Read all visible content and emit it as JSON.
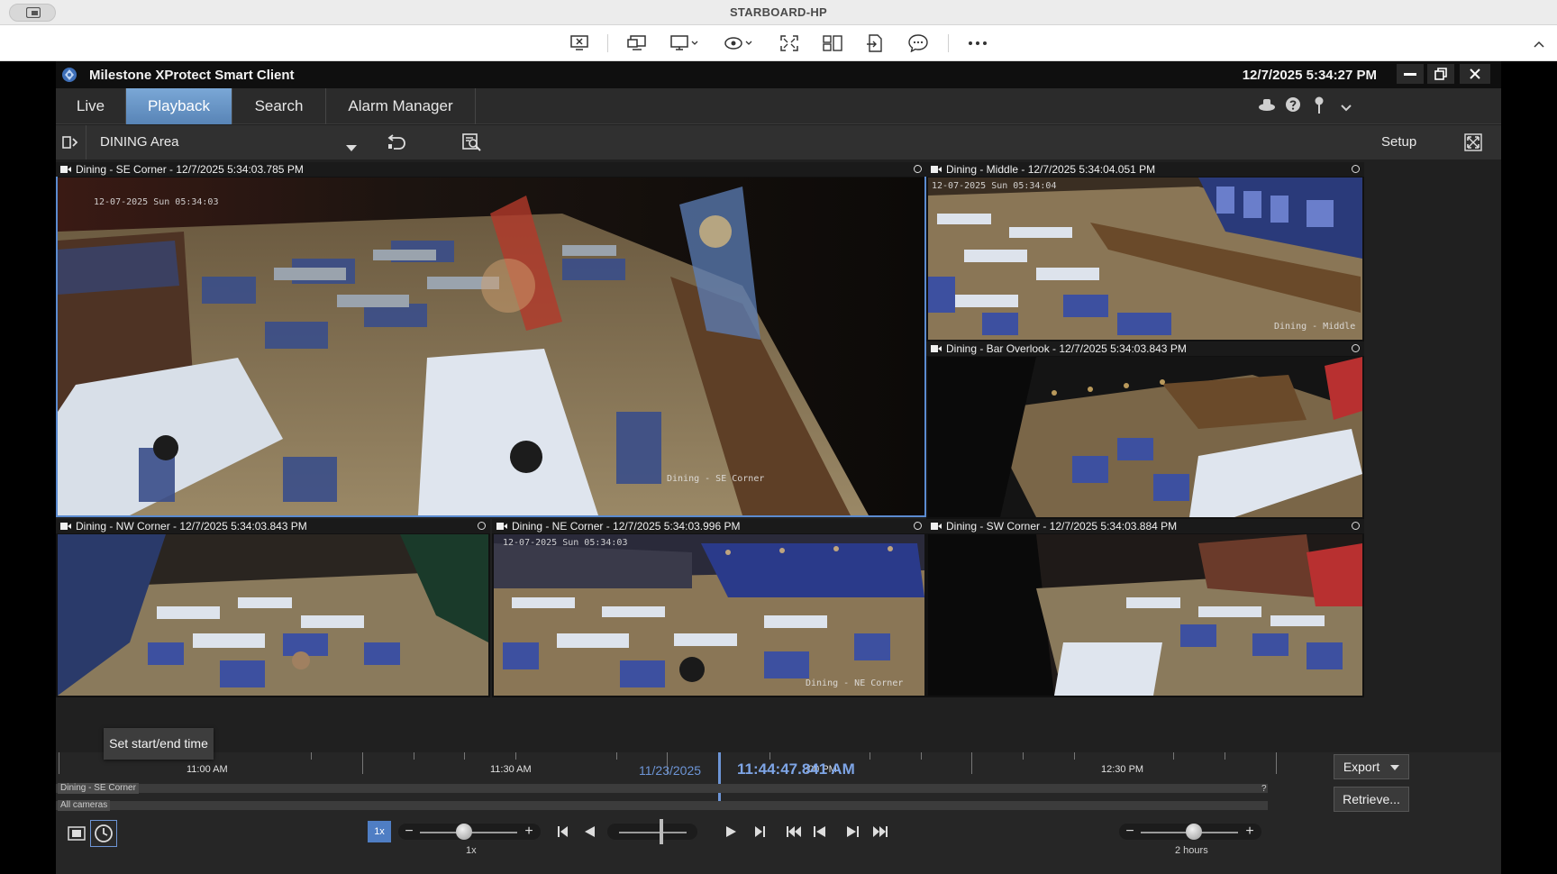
{
  "remote_window": {
    "title": "STARBOARD-HP"
  },
  "app": {
    "title": "Milestone XProtect Smart Client",
    "clock": "12/7/2025 5:34:27 PM",
    "tabs": [
      {
        "label": "Live",
        "active": false
      },
      {
        "label": "Playback",
        "active": true
      },
      {
        "label": "Search",
        "active": false
      },
      {
        "label": "Alarm Manager",
        "active": false
      }
    ],
    "view_name": "DINING Area",
    "setup_label": "Setup"
  },
  "cameras": [
    {
      "label": "Dining - SE Corner - 12/7/2025 5:34:03.785 PM",
      "overlay_time": "12-07-2025 Sun 05:34:03",
      "overlay_name": "Dining - SE Corner",
      "selected": true
    },
    {
      "label": "Dining - Middle - 12/7/2025 5:34:04.051 PM",
      "overlay_time": "12-07-2025 Sun 05:34:04",
      "overlay_name": "Dining - Middle",
      "selected": false
    },
    {
      "label": "Dining - Bar Overlook - 12/7/2025 5:34:03.843 PM",
      "overlay_time": "",
      "overlay_name": "",
      "selected": false
    },
    {
      "label": "Dining - NW Corner - 12/7/2025 5:34:03.843 PM",
      "overlay_time": "",
      "overlay_name": "",
      "selected": false
    },
    {
      "label": "Dining - NE Corner - 12/7/2025 5:34:03.996 PM",
      "overlay_time": "12-07-2025 Sun 05:34:03",
      "overlay_name": "Dining - NE Corner",
      "selected": false
    },
    {
      "label": "Dining - SW Corner - 12/7/2025 5:34:03.884 PM",
      "overlay_time": "",
      "overlay_name": "",
      "selected": false
    }
  ],
  "timeline": {
    "ticks": [
      "11:00 AM",
      "11:30 AM",
      ":00 PM",
      "12:30 PM"
    ],
    "date": "11/23/2025",
    "current_time": "11:44:47.841 AM",
    "track_selected": "Dining - SE Corner",
    "track_all": "All cameras",
    "track_help": "?",
    "tooltip": "Set start/end time",
    "speed_badge": "1x",
    "speed_label": "1x",
    "span_label": "2 hours",
    "export_label": "Export",
    "retrieve_label": "Retrieve...",
    "speed_level": 0.45,
    "span_level": 0.55
  }
}
